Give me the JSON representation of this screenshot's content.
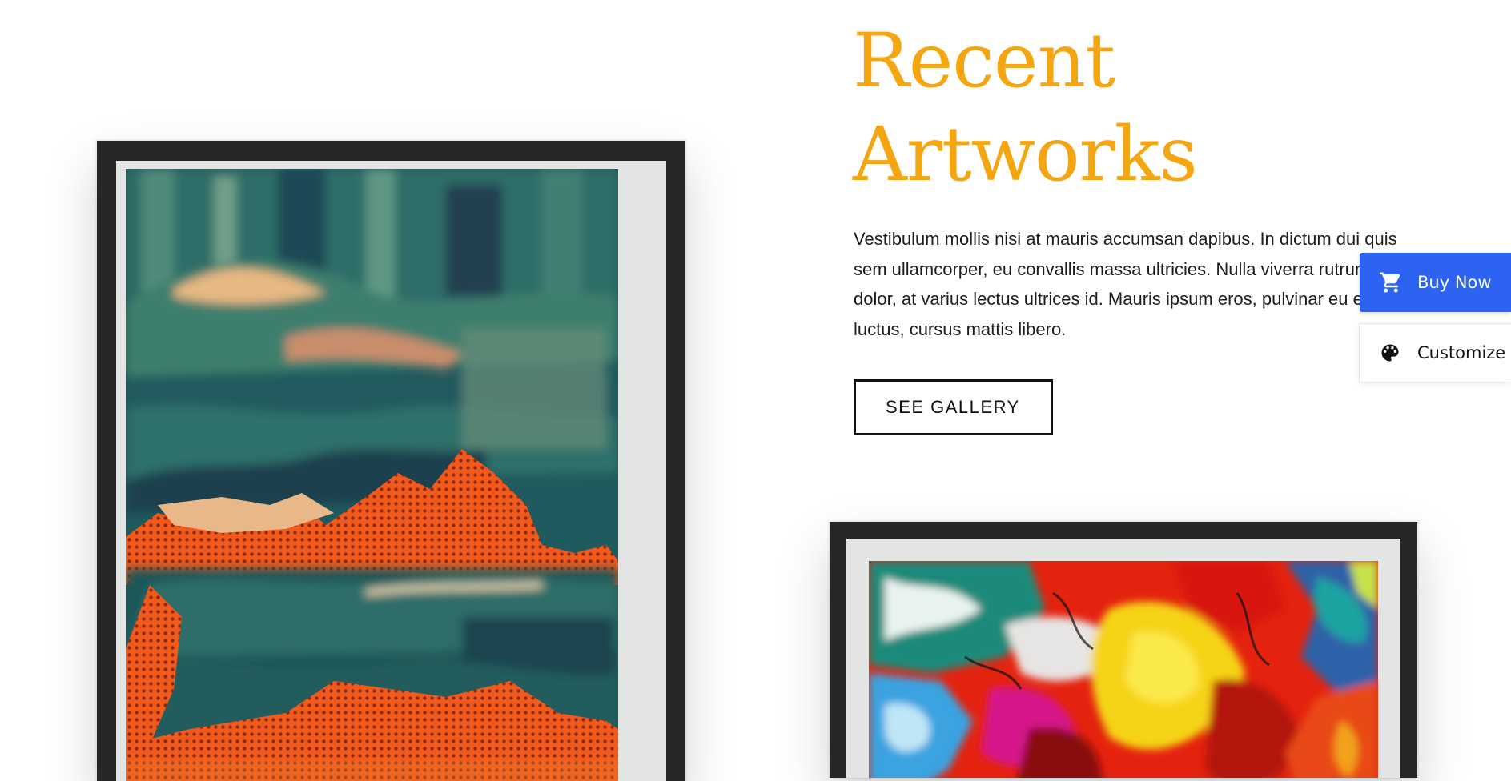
{
  "section": {
    "heading_line1": "Recent",
    "heading_line2": "Artworks",
    "description": "Vestibulum mollis nisi at mauris accumsan dapibus. In dictum dui quis sem ullamcorper, eu convallis massa ultricies. Nulla viverra rutrum dolor, at varius lectus ultrices id. Mauris ipsum eros, pulvinar eu est luctus, cursus mattis libero.",
    "gallery_button": "SEE GALLERY"
  },
  "side_actions": {
    "buy_label": "Buy Now",
    "buy_icon": "cart-icon",
    "customize_label": "Customize",
    "customize_icon": "palette-icon"
  },
  "artworks": [
    {
      "name": "abstract-teal-orange-painting",
      "subject": "abstract painting in teal and orange"
    },
    {
      "name": "abstract-red-yellow-painting",
      "subject": "abstract fluid painting in red, yellow and blue"
    }
  ],
  "colors": {
    "heading": "#f5a50f",
    "buy_button": "#2c63f0",
    "frame": "#262626",
    "mat": "#e3e4e4"
  }
}
